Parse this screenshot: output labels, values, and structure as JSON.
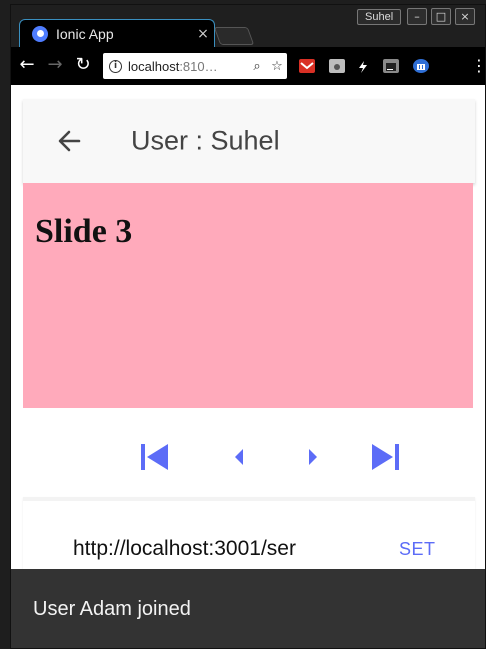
{
  "browser": {
    "tab_title": "Ionic App",
    "tab_close": "×",
    "profile_name": "Suhel",
    "window_buttons": [
      "–",
      "□",
      "×"
    ],
    "back": "←",
    "forward": "→",
    "reload": "↻",
    "url_host": "localhost",
    "url_rest": ":810…",
    "info_glyph": "i",
    "zoom_icon": "⌕",
    "star_icon": "☆",
    "menu_icon": "⋮",
    "extensions": [
      {
        "name": "gmail-extension-icon",
        "color": "#d93025"
      },
      {
        "name": "camera-extension-icon",
        "color": "#bdbdbd"
      },
      {
        "name": "lightning-extension-icon",
        "color": "#ffffff"
      },
      {
        "name": "jb-extension-icon",
        "color": "#8a8a8a"
      },
      {
        "name": "bank-extension-icon",
        "color": "#2f6fd6"
      }
    ]
  },
  "header": {
    "title": "User : Suhel"
  },
  "slide": {
    "title": "Slide 3",
    "background": "#ffaabb"
  },
  "pager": {
    "accent": "#5c6cf7"
  },
  "server": {
    "input_value": "http://localhost:3001/ser",
    "set_label": "SET"
  },
  "toast": {
    "message": "User Adam joined"
  }
}
